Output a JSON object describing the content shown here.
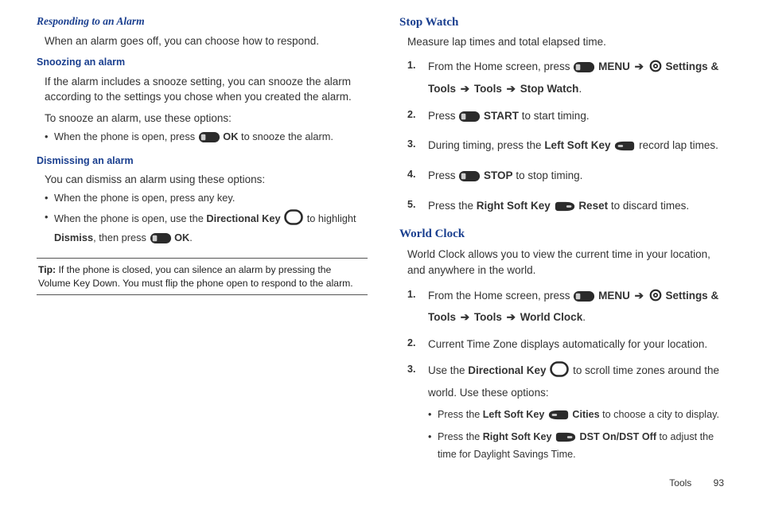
{
  "left": {
    "h_responding": "Responding to an Alarm",
    "p_respond": "When an alarm goes off, you can choose how to respond.",
    "h_snoozing": "Snoozing an alarm",
    "p_snooze1": "If the alarm includes a snooze setting, you can snooze the alarm according to the settings you chose when you created the alarm.",
    "p_snooze2": "To snooze an alarm, use these options:",
    "snooze_b1_a": "When the phone is open, press ",
    "ok": "OK",
    "snooze_b1_b": " to snooze the alarm.",
    "h_dismiss": "Dismissing an alarm",
    "p_dismiss": "You can dismiss an alarm using these options:",
    "dismiss_b1": "When the phone is open, press any key.",
    "dismiss_b2_a": "When the phone is open, use the ",
    "dirkey": "Directional Key",
    "dismiss_b2_b": " to highlight ",
    "dismiss_word": "Dismiss",
    "dismiss_b2_c": ", then press ",
    "dismiss_b2_d": ".",
    "tip_label": "Tip:",
    "tip_text": " If the phone is closed, you can silence an alarm by pressing the Volume Key Down. You must flip the phone open to respond to the alarm."
  },
  "right": {
    "h_stopwatch": "Stop Watch",
    "p_stopwatch": "Measure lap times and total elapsed time.",
    "sw1_a": "From the Home screen, press ",
    "menu": "MENU",
    "sw1_b": "Settings & Tools",
    "tools": "Tools",
    "stopwatch": "Stop Watch",
    "sw2_a": "Press ",
    "start": "START",
    "sw2_b": " to start timing.",
    "sw3_a": "During timing, press the ",
    "lsk": "Left Soft Key",
    "sw3_b": " record lap times.",
    "sw4_a": "Press ",
    "stop": "STOP",
    "sw4_b": " to stop timing.",
    "sw5_a": "Press the ",
    "rsk": "Right Soft Key",
    "reset": "Reset",
    "sw5_b": " to discard times.",
    "h_worldclock": "World Clock",
    "p_worldclock": "World Clock allows you to view the current time in your location, and anywhere in the world.",
    "wc_item": "World Clock",
    "wc2": "Current Time Zone displays automatically for your location.",
    "wc3_a": "Use the ",
    "wc3_b": " to scroll time zones around the world. Use these options:",
    "wc_s1_a": "Press the ",
    "cities": "Cities",
    "wc_s1_b": " to choose a city to display.",
    "wc_s2_a": "Press the ",
    "dst": "DST On/DST Off",
    "wc_s2_b": " to adjust the time for Daylight Savings Time."
  },
  "footer": {
    "section": "Tools",
    "page": "93"
  }
}
